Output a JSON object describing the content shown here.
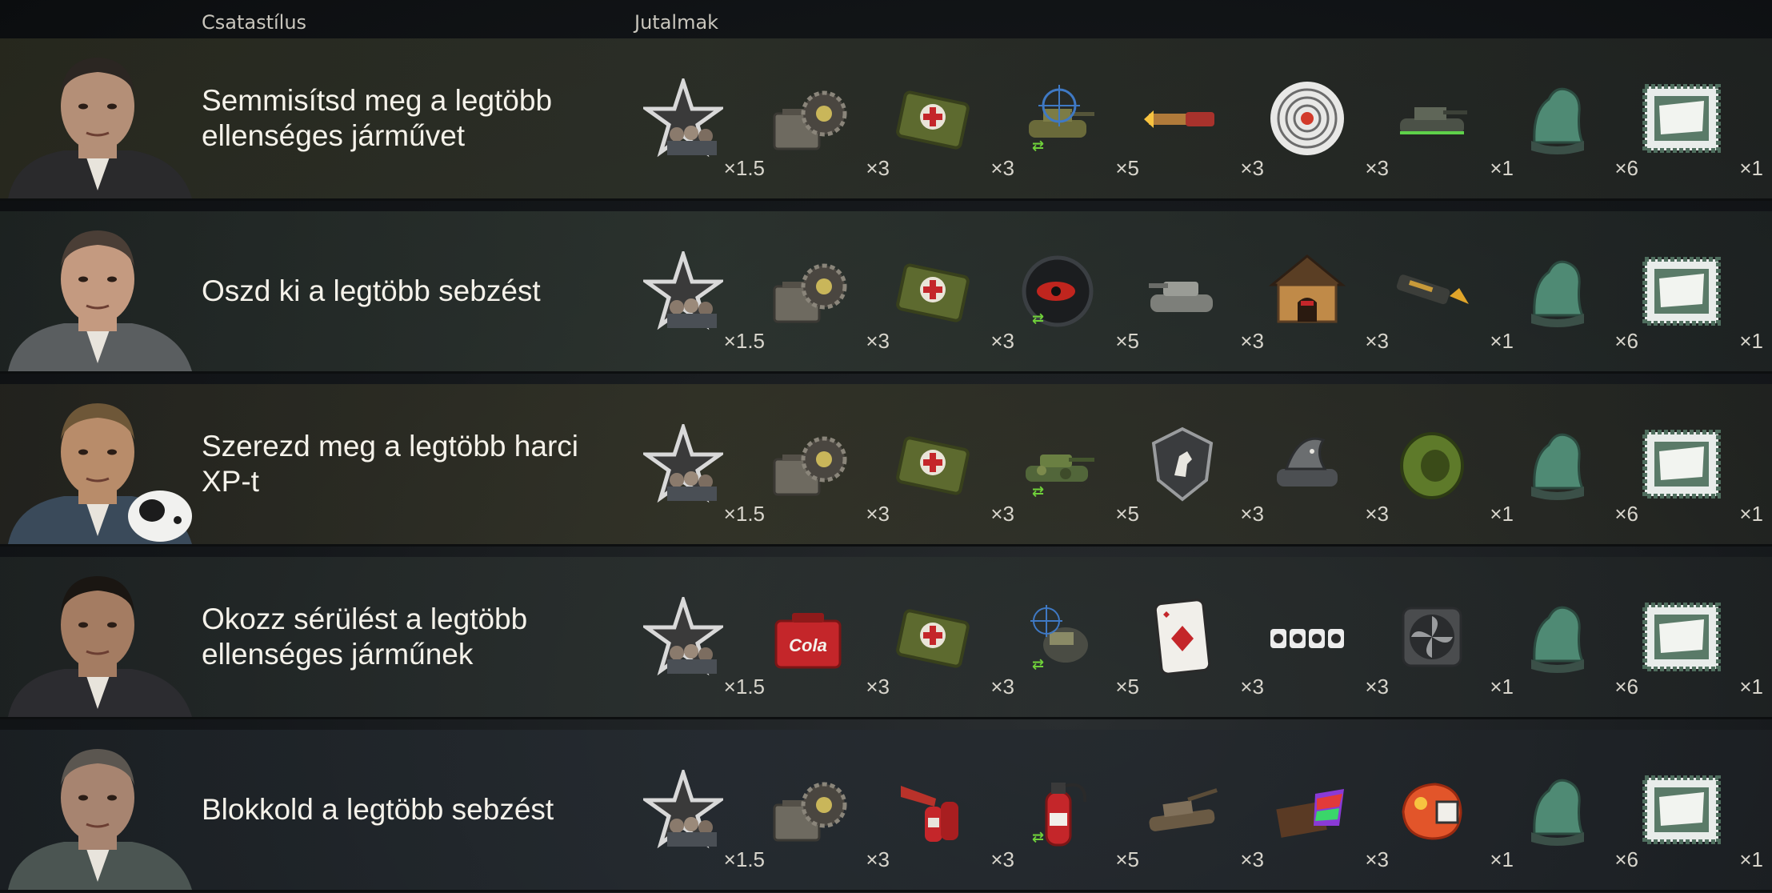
{
  "headers": {
    "style": "Csatastílus",
    "rewards": "Jutalmak"
  },
  "rows": [
    {
      "title": "Semmisítsd meg a legtöbb ellenséges járművet",
      "rewards": [
        {
          "icon": "crew-star-icon",
          "count": "×1.5"
        },
        {
          "icon": "equipment-kit-icon",
          "count": "×3"
        },
        {
          "icon": "first-aid-kit-icon",
          "count": "×3"
        },
        {
          "icon": "tank-target-icon",
          "count": "×5"
        },
        {
          "icon": "shell-icon",
          "count": "×3"
        },
        {
          "icon": "target-icon",
          "count": "×3"
        },
        {
          "icon": "tank-style-icon",
          "count": "×1"
        },
        {
          "icon": "goat-emblem-icon",
          "count": "×6"
        },
        {
          "icon": "document-stamp-icon",
          "count": "×1"
        }
      ]
    },
    {
      "title": "Oszd ki a legtöbb sebzést",
      "rewards": [
        {
          "icon": "crew-star-icon",
          "count": "×1.5"
        },
        {
          "icon": "equipment-kit-icon",
          "count": "×3"
        },
        {
          "icon": "first-aid-kit-icon",
          "count": "×3"
        },
        {
          "icon": "red-eye-icon",
          "count": "×5"
        },
        {
          "icon": "gray-tank-icon",
          "count": "×3"
        },
        {
          "icon": "doghouse-icon",
          "count": "×3"
        },
        {
          "icon": "rocket-icon",
          "count": "×1"
        },
        {
          "icon": "goat-emblem-icon",
          "count": "×6"
        },
        {
          "icon": "document-stamp-icon",
          "count": "×1"
        }
      ]
    },
    {
      "title": "Szerezd meg a legtöbb harci XP-t",
      "rewards": [
        {
          "icon": "crew-star-icon",
          "count": "×1.5"
        },
        {
          "icon": "equipment-kit-icon",
          "count": "×3"
        },
        {
          "icon": "first-aid-kit-icon",
          "count": "×3"
        },
        {
          "icon": "camo-tank-icon",
          "count": "×5"
        },
        {
          "icon": "deer-emblem-icon",
          "count": "×3"
        },
        {
          "icon": "shark-tank-icon",
          "count": "×3"
        },
        {
          "icon": "green-disc-icon",
          "count": "×1"
        },
        {
          "icon": "goat-emblem-icon",
          "count": "×6"
        },
        {
          "icon": "document-stamp-icon",
          "count": "×1"
        }
      ]
    },
    {
      "title": "Okozz sérülést a legtöbb ellenséges járműnek",
      "rewards": [
        {
          "icon": "crew-star-icon",
          "count": "×1.5"
        },
        {
          "icon": "cola-box-icon",
          "count": "×3"
        },
        {
          "icon": "first-aid-kit-icon",
          "count": "×3"
        },
        {
          "icon": "turret-target-icon",
          "count": "×5"
        },
        {
          "icon": "playing-card-icon",
          "count": "×3"
        },
        {
          "icon": "cards-row-icon",
          "count": "×3"
        },
        {
          "icon": "fan-icon",
          "count": "×1"
        },
        {
          "icon": "goat-emblem-icon",
          "count": "×6"
        },
        {
          "icon": "document-stamp-icon",
          "count": "×1"
        }
      ]
    },
    {
      "title": "Blokkold a legtöbb sebzést",
      "rewards": [
        {
          "icon": "crew-star-icon",
          "count": "×1.5"
        },
        {
          "icon": "equipment-kit-icon",
          "count": "×3"
        },
        {
          "icon": "horn-bottles-icon",
          "count": "×3"
        },
        {
          "icon": "fire-extinguisher-icon",
          "count": "×5"
        },
        {
          "icon": "wrecked-tank-icon",
          "count": "×3"
        },
        {
          "icon": "rainbow-box-icon",
          "count": "×3"
        },
        {
          "icon": "orange-module-icon",
          "count": "×1"
        },
        {
          "icon": "goat-emblem-icon",
          "count": "×6"
        },
        {
          "icon": "document-stamp-icon",
          "count": "×1"
        }
      ]
    }
  ],
  "colors": {
    "text": "#f5f2ea",
    "count": "#d8d5cc",
    "swap": "#6fcf3a",
    "accent": "#d23a2a"
  }
}
